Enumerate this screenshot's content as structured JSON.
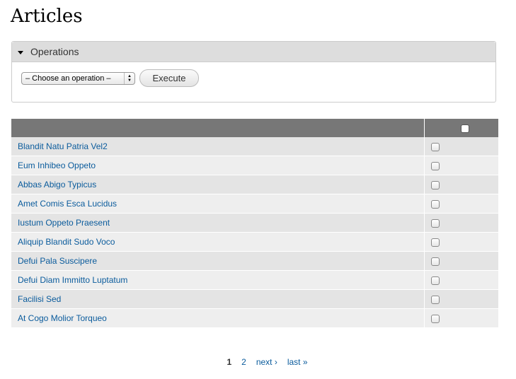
{
  "page": {
    "title": "Articles"
  },
  "operations": {
    "legend": "Operations",
    "select_value": "– Choose an operation –",
    "execute_label": "Execute"
  },
  "table": {
    "rows": [
      {
        "title": "Blandit Natu Patria Vel2"
      },
      {
        "title": "Eum Inhibeo Oppeto"
      },
      {
        "title": "Abbas Abigo Typicus"
      },
      {
        "title": "Amet Comis Esca Lucidus"
      },
      {
        "title": "Iustum Oppeto Praesent"
      },
      {
        "title": "Aliquip Blandit Sudo Voco"
      },
      {
        "title": "Defui Pala Suscipere"
      },
      {
        "title": "Defui Diam Immitto Luptatum"
      },
      {
        "title": "Facilisi Sed"
      },
      {
        "title": "At Cogo Molior Torqueo"
      }
    ]
  },
  "pager": {
    "current": "1",
    "page2": "2",
    "next": "next ›",
    "last": "last »"
  },
  "colors": {
    "link": "#0a5b9c",
    "header_bg": "#777777",
    "legend_bg": "#dddddd"
  },
  "icons": {
    "collapse": "collapse-triangle-icon",
    "select_arrows": "select-arrows-icon"
  }
}
